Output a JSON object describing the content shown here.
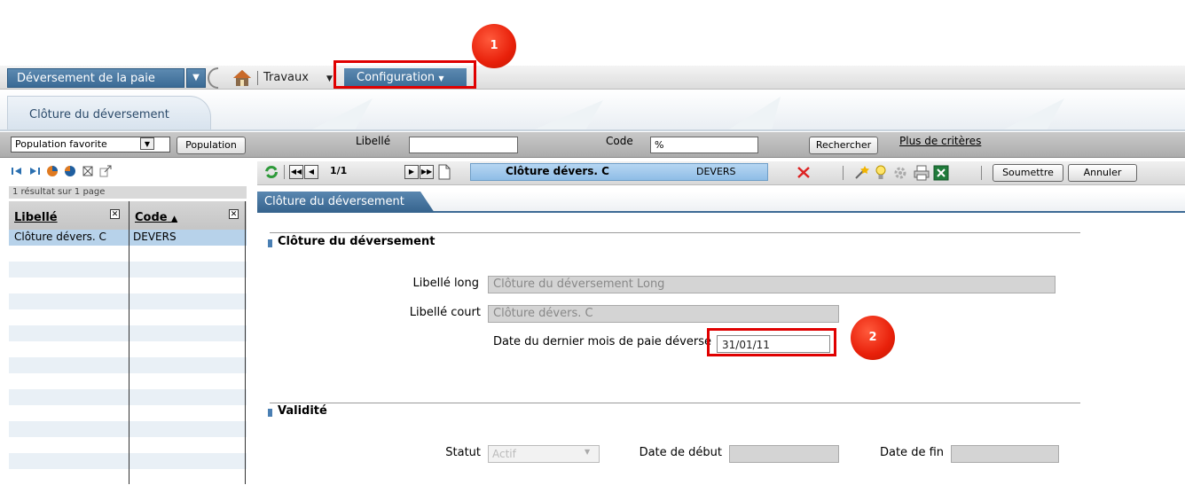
{
  "topnav": {
    "module_label": "Déversement de la paie",
    "travaux_label": "Travaux",
    "config_label": "Configuration"
  },
  "callouts": {
    "one": "1",
    "two": "2"
  },
  "page_tab": {
    "label": "Clôture du déversement"
  },
  "criteria": {
    "population_select": "Population favorite",
    "population_button": "Population",
    "libelle_label": "Libellé",
    "libelle_value": "",
    "code_label": "Code",
    "code_value": "%",
    "search_button": "Rechercher",
    "more_criteria_link": "Plus de critères"
  },
  "list": {
    "result_info": "1 résultat sur 1 page",
    "col_libelle": "Libellé",
    "col_code": "Code",
    "sort_indicator": "▲",
    "rows": [
      {
        "libelle": "Clôture dévers. C",
        "code": "DEVERS"
      }
    ]
  },
  "record_toolbar": {
    "pager": "1/1",
    "record_title": "Clôture dévers. C",
    "record_code": "DEVERS",
    "submit_button": "Soumettre",
    "cancel_button": "Annuler"
  },
  "section_tab": {
    "label": "Clôture du déversement"
  },
  "form": {
    "fieldset_main_title": "Clôture du déversement",
    "libelle_long_label": "Libellé long",
    "libelle_long_value": "Clôture du déversement Long",
    "libelle_court_label": "Libellé court",
    "libelle_court_value": "Clôture dévers. C",
    "date_label": "Date du dernier mois de paie déversé",
    "date_value": "31/01/11",
    "fieldset_validity_title": "Validité",
    "statut_label": "Statut",
    "statut_value": "Actif",
    "date_debut_label": "Date de début",
    "date_debut_value": "",
    "date_fin_label": "Date de fin",
    "date_fin_value": ""
  },
  "colors": {
    "nav_blue": "#3a6a95",
    "highlight_red": "#e00000",
    "selected_row": "#b7d2ea"
  }
}
